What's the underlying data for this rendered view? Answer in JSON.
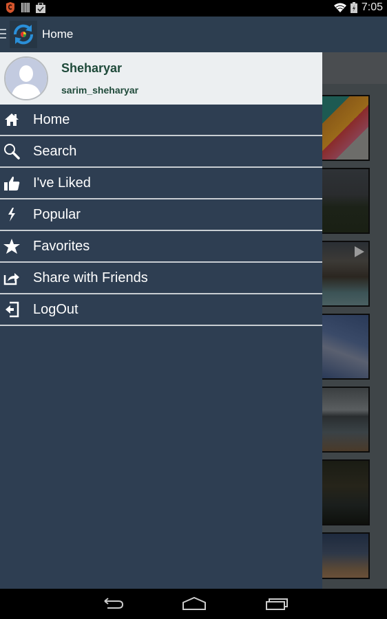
{
  "status_bar": {
    "time": "7:05",
    "left_icons": [
      "shield-notification-icon",
      "barcode-notification-icon",
      "clipboard-check-icon"
    ],
    "right_icons": [
      "wifi-icon",
      "battery-charging-icon"
    ]
  },
  "action_bar": {
    "title": "Home",
    "logo": "sync-app-logo"
  },
  "drawer": {
    "profile": {
      "name": "Sheharyar",
      "username": "sarim_sheharyar"
    },
    "menu": [
      {
        "label": "Home",
        "icon": "home-icon"
      },
      {
        "label": "Search",
        "icon": "search-icon"
      },
      {
        "label": "I've Liked",
        "icon": "thumbs-up-icon"
      },
      {
        "label": "Popular",
        "icon": "lightning-icon"
      },
      {
        "label": "Favorites",
        "icon": "star-icon"
      },
      {
        "label": "Share with Friends",
        "icon": "share-icon"
      },
      {
        "label": "LogOut",
        "icon": "logout-icon"
      }
    ]
  },
  "background_feed": {
    "thumbnails": [
      {
        "subject": "colorful geometric wall"
      },
      {
        "subject": "dark meadow with trees"
      },
      {
        "subject": "selfie video",
        "has_play": true
      },
      {
        "subject": "clouds in sky"
      },
      {
        "subject": "canoe on lake"
      },
      {
        "subject": "trees at night"
      },
      {
        "subject": "tower at sunset"
      }
    ]
  },
  "nav_bar": {
    "buttons": [
      "back",
      "home",
      "recent-apps"
    ]
  }
}
